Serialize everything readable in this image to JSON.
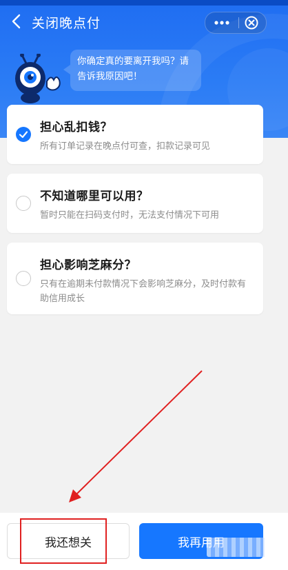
{
  "header": {
    "title": "关闭晚点付",
    "back_icon": "chevron-left-icon",
    "more_icon": "more-dots-icon",
    "close_icon": "close-circle-icon"
  },
  "mascot": {
    "icon": "ant-mascot-icon",
    "message": "你确定真的要离开我吗？请告诉我原因吧！"
  },
  "reasons": [
    {
      "title": "担心乱扣钱？",
      "description": "所有订单记录在晚点付可查，扣款记录可见",
      "selected": true
    },
    {
      "title": "不知道哪里可以用？",
      "description": "暂时只能在扫码支付时，无法支付情况下可用",
      "selected": false
    },
    {
      "title": "担心影响芝麻分？",
      "description": "只有在逾期未付款情况下会影响芝麻分，及时付款有助信用成长",
      "selected": false
    }
  ],
  "footer": {
    "close_label": "我还想关",
    "keep_label": "我再用用"
  },
  "colors": {
    "brand_blue": "#1677ff",
    "annotation_red": "#e02020"
  }
}
